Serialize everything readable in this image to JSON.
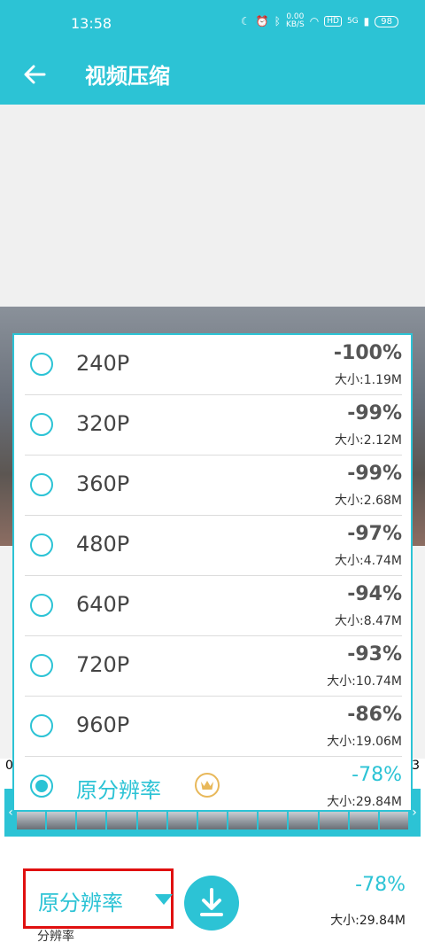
{
  "status": {
    "time": "13:58",
    "speed_top": "0.00",
    "speed_bottom": "KB/S",
    "hd": "HD",
    "network": "5G",
    "battery": "98"
  },
  "appbar": {
    "title": "视频压缩"
  },
  "timeline": {
    "left": "0",
    "right": "3"
  },
  "options": [
    {
      "label": "240P",
      "pct": "-100%",
      "size": "大小:1.19M"
    },
    {
      "label": "320P",
      "pct": "-99%",
      "size": "大小:2.12M"
    },
    {
      "label": "360P",
      "pct": "-99%",
      "size": "大小:2.68M"
    },
    {
      "label": "480P",
      "pct": "-97%",
      "size": "大小:4.74M"
    },
    {
      "label": "640P",
      "pct": "-94%",
      "size": "大小:8.47M"
    },
    {
      "label": "720P",
      "pct": "-93%",
      "size": "大小:10.74M"
    },
    {
      "label": "960P",
      "pct": "-86%",
      "size": "大小:19.06M"
    },
    {
      "label": "原分辨率",
      "pct": "-78%",
      "size": "大小:29.84M"
    }
  ],
  "bottom": {
    "resolution": "原分辨率",
    "under_label": "分辨率",
    "pct": "-78%",
    "size": "大小:29.84M"
  },
  "colors": {
    "accent": "#2cc3d5",
    "highlight": "#e01010",
    "crown": "#e8b85a"
  }
}
